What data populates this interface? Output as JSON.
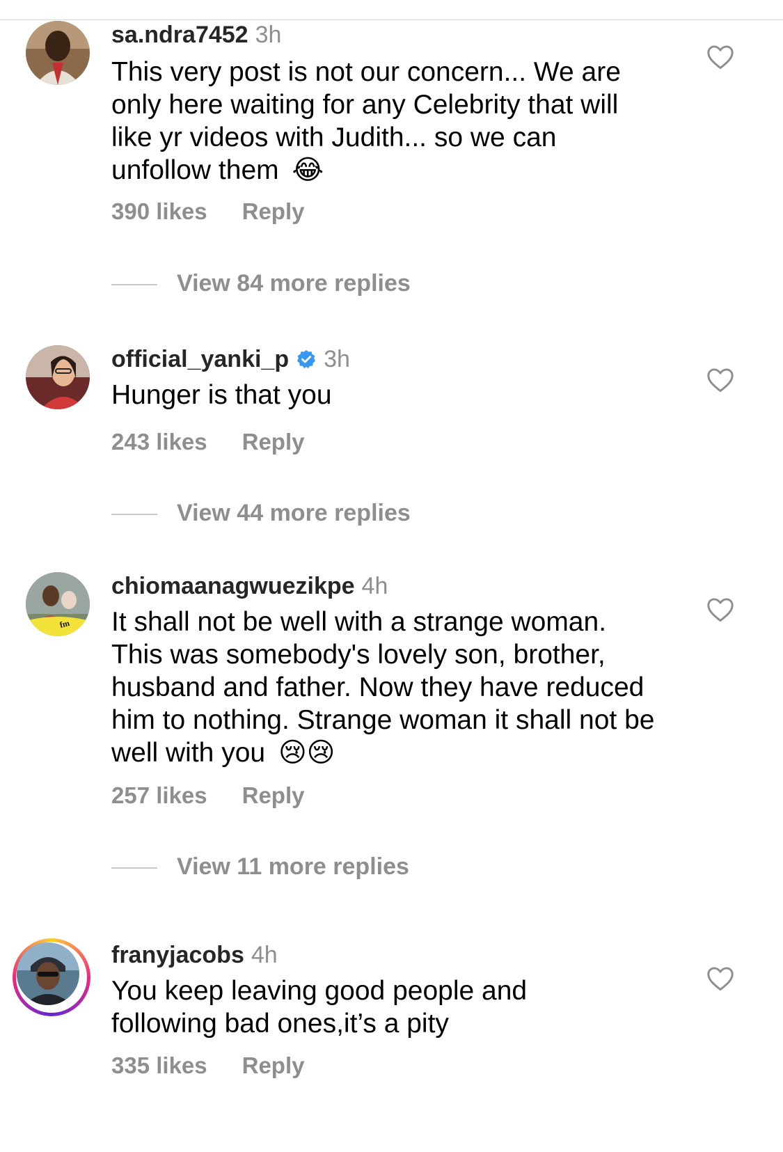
{
  "comments": [
    {
      "username": "sa.ndra7452",
      "time": "3h",
      "text": "This very post is not our concern... We are only here waiting for any Celebrity that will like yr videos with Judith... so we can unfollow them",
      "emoji": "😂",
      "likes": "390 likes",
      "reply": "Reply",
      "view_more": "View 84 more replies"
    },
    {
      "username": "official_yanki_p",
      "verified": true,
      "time": "3h",
      "text": "Hunger is that you",
      "likes": "243 likes",
      "reply": "Reply",
      "view_more": "View 44 more replies"
    },
    {
      "username": "chiomaanagwuezikpe",
      "time": "4h",
      "text": "It shall not be well with a strange woman. This was somebody's lovely son, brother, husband and father. Now they have reduced him to nothing. Strange woman it shall not be well with you",
      "emoji": "😢😢",
      "likes": "257 likes",
      "reply": "Reply",
      "view_more": "View 11 more replies"
    },
    {
      "username": "franyjacobs",
      "time": "4h",
      "text": "You keep leaving good people and following bad ones,it’s a pity",
      "likes": "335 likes",
      "reply": "Reply"
    }
  ],
  "colors": {
    "secondary_text": "#8e8e8e",
    "verified_badge": "#3897f0"
  },
  "icons": {
    "like": "heart-outline-icon",
    "verified": "verified-badge-icon"
  }
}
